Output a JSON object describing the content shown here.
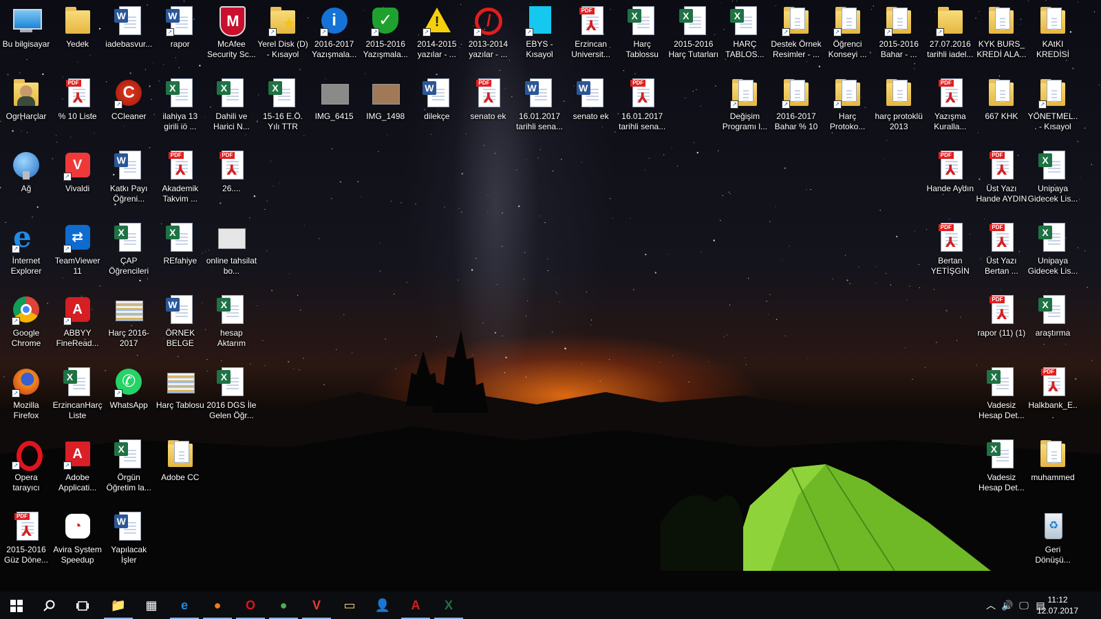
{
  "desktop": {
    "icons": [
      {
        "label": "Bu bilgisayar",
        "type": "computer",
        "col": 0,
        "row": 0,
        "shortcut": false
      },
      {
        "label": "Yedek",
        "type": "folder",
        "col": 1,
        "row": 0,
        "shortcut": false
      },
      {
        "label": "iadebasvur...",
        "type": "word",
        "col": 2,
        "row": 0,
        "shortcut": false
      },
      {
        "label": "rapor",
        "type": "word",
        "col": 3,
        "row": 0,
        "shortcut": true
      },
      {
        "label": "McAfee Security Sc...",
        "type": "mcafee",
        "col": 4,
        "row": 0,
        "shortcut": false
      },
      {
        "label": "Yerel Disk (D) - Kısayol",
        "type": "folder-star",
        "col": 5,
        "row": 0,
        "shortcut": true
      },
      {
        "label": "2016-2017 Yazışmala...",
        "type": "info",
        "col": 6,
        "row": 0,
        "shortcut": true
      },
      {
        "label": "2015-2016 Yazışmala...",
        "type": "check",
        "col": 7,
        "row": 0,
        "shortcut": true
      },
      {
        "label": "2014-2015 yazılar - ...",
        "type": "warning",
        "col": 8,
        "row": 0,
        "shortcut": true
      },
      {
        "label": "2013-2014 yazılar - ...",
        "type": "block",
        "col": 9,
        "row": 0,
        "shortcut": true
      },
      {
        "label": "EBYS - Kısayol",
        "type": "cyan-file",
        "col": 10,
        "row": 0,
        "shortcut": true
      },
      {
        "label": "Erzincan Universit...",
        "type": "pdf",
        "col": 11,
        "row": 0,
        "shortcut": false
      },
      {
        "label": "Harç Tablossu",
        "type": "excel",
        "col": 12,
        "row": 0,
        "shortcut": false
      },
      {
        "label": "2015-2016 Harç Tutarları",
        "type": "excel",
        "col": 13,
        "row": 0,
        "shortcut": false
      },
      {
        "label": "HARÇ TABLOS...",
        "type": "excel",
        "col": 14,
        "row": 0,
        "shortcut": false
      },
      {
        "label": "Destek Örnek Resimler - ...",
        "type": "folder-doc",
        "col": 15,
        "row": 0,
        "shortcut": true
      },
      {
        "label": "Öğrenci Konseyi ...",
        "type": "folder-doc",
        "col": 16,
        "row": 0,
        "shortcut": true
      },
      {
        "label": "2015-2016 Bahar - ...",
        "type": "folder-doc",
        "col": 17,
        "row": 0,
        "shortcut": true
      },
      {
        "label": "27.07.2016 tarihli iadel...",
        "type": "folder",
        "col": 18,
        "row": 0,
        "shortcut": true
      },
      {
        "label": "KYK BURS_ KREDİ ALA...",
        "type": "folder-doc",
        "col": 19,
        "row": 0,
        "shortcut": false
      },
      {
        "label": "KAtKI KREDİSİ",
        "type": "folder-doc",
        "col": 20,
        "row": 0,
        "shortcut": false
      },
      {
        "label": "OgrHarçlar",
        "type": "user-folder",
        "col": 0,
        "row": 1,
        "shortcut": false
      },
      {
        "label": "% 10 Liste",
        "type": "pdf",
        "col": 1,
        "row": 1,
        "shortcut": false
      },
      {
        "label": "CCleaner",
        "type": "ccleaner",
        "col": 2,
        "row": 1,
        "shortcut": true
      },
      {
        "label": "ilahiya 13 girili iö ...",
        "type": "excel",
        "col": 3,
        "row": 1,
        "shortcut": false
      },
      {
        "label": "Dahili ve Harici N...",
        "type": "excel",
        "col": 4,
        "row": 1,
        "shortcut": false
      },
      {
        "label": "15-16 E.Ö. Yılı TTR",
        "type": "excel",
        "col": 5,
        "row": 1,
        "shortcut": false
      },
      {
        "label": "IMG_6415",
        "type": "photo-gray",
        "col": 6,
        "row": 1,
        "shortcut": false
      },
      {
        "label": "IMG_1498",
        "type": "photo-tan",
        "col": 7,
        "row": 1,
        "shortcut": false
      },
      {
        "label": "dilekçe",
        "type": "word",
        "col": 8,
        "row": 1,
        "shortcut": false
      },
      {
        "label": "senato ek",
        "type": "pdf",
        "col": 9,
        "row": 1,
        "shortcut": false
      },
      {
        "label": "16.01.2017 tarihli sena...",
        "type": "word",
        "col": 10,
        "row": 1,
        "shortcut": false
      },
      {
        "label": "senato ek",
        "type": "word",
        "col": 11,
        "row": 1,
        "shortcut": false
      },
      {
        "label": "16.01.2017 tarihli sena...",
        "type": "pdf",
        "col": 12,
        "row": 1,
        "shortcut": false
      },
      {
        "label": "Değişim Programı l...",
        "type": "folder-doc",
        "col": 14,
        "row": 1,
        "shortcut": true
      },
      {
        "label": "2016-2017 Bahar % 10",
        "type": "folder-doc",
        "col": 15,
        "row": 1,
        "shortcut": true
      },
      {
        "label": "Harç Protoko...",
        "type": "folder-doc",
        "col": 16,
        "row": 1,
        "shortcut": true
      },
      {
        "label": "harç protoklü 2013",
        "type": "folder-doc",
        "col": 17,
        "row": 1,
        "shortcut": false
      },
      {
        "label": "Yazışma Kuralla...",
        "type": "pdf",
        "col": 18,
        "row": 1,
        "shortcut": false
      },
      {
        "label": "667 KHK",
        "type": "folder-doc",
        "col": 19,
        "row": 1,
        "shortcut": false
      },
      {
        "label": "YÖNETMEL... - Kısayol",
        "type": "folder-doc",
        "col": 20,
        "row": 1,
        "shortcut": true
      },
      {
        "label": "Ağ",
        "type": "network",
        "col": 0,
        "row": 2,
        "shortcut": false
      },
      {
        "label": "Vivaldi",
        "type": "vivaldi",
        "col": 1,
        "row": 2,
        "shortcut": true
      },
      {
        "label": "Katkı Payı Öğreni...",
        "type": "word",
        "col": 2,
        "row": 2,
        "shortcut": false
      },
      {
        "label": "Akademik Takvim ...",
        "type": "pdf",
        "col": 3,
        "row": 2,
        "shortcut": false
      },
      {
        "label": "26....",
        "type": "pdf",
        "col": 4,
        "row": 2,
        "shortcut": false
      },
      {
        "label": "Hande Aydın",
        "type": "pdf",
        "col": 18,
        "row": 2,
        "shortcut": false
      },
      {
        "label": "Üst Yazı Hande AYDIN",
        "type": "pdf",
        "col": 19,
        "row": 2,
        "shortcut": false
      },
      {
        "label": "Unipaya Gidecek Lis...",
        "type": "excel",
        "col": 20,
        "row": 2,
        "shortcut": false
      },
      {
        "label": "İnternet Explorer",
        "type": "ie",
        "col": 0,
        "row": 3,
        "shortcut": true
      },
      {
        "label": "TeamViewer 11",
        "type": "teamviewer",
        "col": 1,
        "row": 3,
        "shortcut": true
      },
      {
        "label": "ÇAP Öğrencileri",
        "type": "excel",
        "col": 2,
        "row": 3,
        "shortcut": false
      },
      {
        "label": "REfahiye",
        "type": "excel",
        "col": 3,
        "row": 3,
        "shortcut": false
      },
      {
        "label": "online tahsilat bo...",
        "type": "photo-light",
        "col": 4,
        "row": 3,
        "shortcut": false
      },
      {
        "label": "Bertan YETİŞGİN",
        "type": "pdf",
        "col": 18,
        "row": 3,
        "shortcut": false
      },
      {
        "label": "Üst Yazı Bertan ...",
        "type": "pdf",
        "col": 19,
        "row": 3,
        "shortcut": false
      },
      {
        "label": "Unipaya Gidecek Lis...",
        "type": "excel",
        "col": 20,
        "row": 3,
        "shortcut": false
      },
      {
        "label": "Google Chrome",
        "type": "chrome",
        "col": 0,
        "row": 4,
        "shortcut": true
      },
      {
        "label": "ABBYY FineRead...",
        "type": "abbyy",
        "col": 1,
        "row": 4,
        "shortcut": true
      },
      {
        "label": "Harç 2016-2017",
        "type": "photo-table",
        "col": 2,
        "row": 4,
        "shortcut": false
      },
      {
        "label": "ÖRNEK BELGE",
        "type": "word",
        "col": 3,
        "row": 4,
        "shortcut": false
      },
      {
        "label": "hesap Aktarım",
        "type": "excel",
        "col": 4,
        "row": 4,
        "shortcut": false
      },
      {
        "label": "rapor (11) (1)",
        "type": "pdf",
        "col": 19,
        "row": 4,
        "shortcut": false
      },
      {
        "label": "araştırma",
        "type": "excel",
        "col": 20,
        "row": 4,
        "shortcut": false
      },
      {
        "label": "Mozilla Firefox",
        "type": "firefox",
        "col": 0,
        "row": 5,
        "shortcut": true
      },
      {
        "label": "ErzincanHarç Liste",
        "type": "excel",
        "col": 1,
        "row": 5,
        "shortcut": false
      },
      {
        "label": "WhatsApp",
        "type": "whatsapp",
        "col": 2,
        "row": 5,
        "shortcut": true
      },
      {
        "label": "Harç Tablosu",
        "type": "photo-table",
        "col": 3,
        "row": 5,
        "shortcut": false
      },
      {
        "label": "2016 DGS İle Gelen Öğr...",
        "type": "excel",
        "col": 4,
        "row": 5,
        "shortcut": false
      },
      {
        "label": "Vadesiz Hesap Det...",
        "type": "excel",
        "col": 19,
        "row": 5,
        "shortcut": false
      },
      {
        "label": "Halkbank_E...",
        "type": "pdf",
        "col": 20,
        "row": 5,
        "shortcut": false
      },
      {
        "label": "Opera tarayıcı",
        "type": "opera",
        "col": 0,
        "row": 6,
        "shortcut": true
      },
      {
        "label": "Adobe Applicati...",
        "type": "adobe",
        "col": 1,
        "row": 6,
        "shortcut": true
      },
      {
        "label": "Örgün Öğretim la...",
        "type": "excel",
        "col": 2,
        "row": 6,
        "shortcut": false
      },
      {
        "label": "Adobe CC",
        "type": "folder-doc",
        "col": 3,
        "row": 6,
        "shortcut": false
      },
      {
        "label": "Vadesiz Hesap Det...",
        "type": "excel",
        "col": 19,
        "row": 6,
        "shortcut": false
      },
      {
        "label": "muhammed",
        "type": "folder-doc",
        "col": 20,
        "row": 6,
        "shortcut": false
      },
      {
        "label": "2015-2016 Güz Döne...",
        "type": "pdf",
        "col": 0,
        "row": 7,
        "shortcut": false
      },
      {
        "label": "Avira System Speedup",
        "type": "avira",
        "col": 1,
        "row": 7,
        "shortcut": false
      },
      {
        "label": "Yapılacak İşler",
        "type": "word",
        "col": 2,
        "row": 7,
        "shortcut": false
      },
      {
        "label": "Geri Dönüşü...",
        "type": "recycle",
        "col": 20,
        "row": 7,
        "shortcut": false
      }
    ]
  },
  "taskbar": {
    "start_icon": "windows-start-icon",
    "search_icon": "search-icon",
    "task_view_icon": "task-view-icon",
    "pinned": [
      {
        "name": "file-explorer",
        "glyph": "📁",
        "active": true
      },
      {
        "name": "calculator",
        "glyph": "▦",
        "active": false
      },
      {
        "name": "internet-explorer",
        "glyph": "e",
        "active": true
      },
      {
        "name": "firefox",
        "glyph": "●",
        "active": true
      },
      {
        "name": "opera",
        "glyph": "O",
        "active": true
      },
      {
        "name": "chrome",
        "glyph": "●",
        "active": true
      },
      {
        "name": "vivaldi",
        "glyph": "V",
        "active": true
      },
      {
        "name": "folder-app",
        "glyph": "▭",
        "active": false
      },
      {
        "name": "people-app",
        "glyph": "👤",
        "active": false
      },
      {
        "name": "acrobat",
        "glyph": "A",
        "active": true
      },
      {
        "name": "excel",
        "glyph": "X",
        "active": true
      }
    ],
    "tray": {
      "chevron_icon": "chevron-up-icon",
      "volume_icon": "volume-icon",
      "network_icon": "network-icon",
      "notification_icon": "notification-icon"
    },
    "clock": {
      "time": "11:12",
      "date": "12.07.2017"
    }
  },
  "colors": {
    "taskbar": "#0c0d10",
    "label": "#ffffff",
    "active_indicator": "#8cb4e6"
  }
}
